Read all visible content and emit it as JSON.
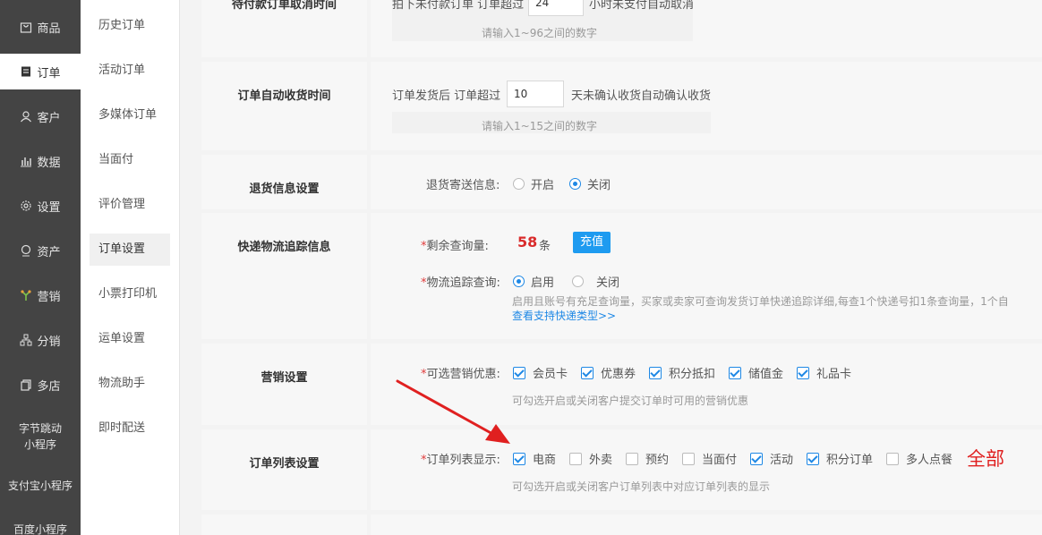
{
  "nav": {
    "items": [
      {
        "label": "商品",
        "icon": "bag-icon"
      },
      {
        "label": "订单",
        "icon": "order-icon"
      },
      {
        "label": "客户",
        "icon": "user-icon"
      },
      {
        "label": "数据",
        "icon": "chart-icon"
      },
      {
        "label": "设置",
        "icon": "gear-icon"
      },
      {
        "label": "资产",
        "icon": "coin-icon"
      },
      {
        "label": "营销",
        "icon": "branch-icon"
      },
      {
        "label": "分销",
        "icon": "share-icon"
      },
      {
        "label": "多店",
        "icon": "store-icon"
      },
      {
        "label": "字节跳动\n小程序"
      },
      {
        "label": "支付宝小程序"
      },
      {
        "label": "百度小程序"
      }
    ]
  },
  "subnav": {
    "items": [
      "历史订单",
      "活动订单",
      "多媒体订单",
      "当面付",
      "评价管理",
      "订单设置",
      "小票打印机",
      "运单设置",
      "物流助手",
      "即时配送"
    ]
  },
  "rows": {
    "cancel": {
      "label": "待付款订单取消时间",
      "prefix": "拍下未付款订单 订单超过",
      "value": "24",
      "suffix": "小时未支付自动取消",
      "hint": "请输入1~96之间的数字"
    },
    "receive": {
      "label": "订单自动收货时间",
      "prefix": "订单发货后 订单超过",
      "value": "10",
      "suffix": "天未确认收货自动确认收货",
      "hint": "请输入1~15之间的数字"
    },
    "returns": {
      "label": "退货信息设置",
      "field": "退货寄送信息:",
      "opt_on": "开启",
      "opt_off": "关闭"
    },
    "express": {
      "label": "快递物流追踪信息",
      "remain_label": "剩余查询量:",
      "remain_value": "58",
      "remain_unit": "条",
      "recharge": "充值",
      "track_label": "物流追踪查询:",
      "opt_on": "启用",
      "opt_off": "关闭",
      "note": "启用且账号有充足查询量，买家或卖家可查询发货订单快递追踪详细,每查1个快递号扣1条查询量，1个自",
      "link": "查看支持快递类型>>"
    },
    "marketing": {
      "label": "营销设置",
      "field": "可选营销优惠:",
      "options": [
        "会员卡",
        "优惠券",
        "积分抵扣",
        "储值金",
        "礼品卡"
      ],
      "hint": "可勾选开启或关闭客户提交订单时可用的营销优惠"
    },
    "orderlist": {
      "label": "订单列表设置",
      "field": "订单列表显示:",
      "options": [
        "电商",
        "外卖",
        "预约",
        "当面付",
        "活动",
        "积分订单",
        "多人点餐"
      ],
      "checked": [
        true,
        false,
        false,
        false,
        true,
        true,
        false
      ],
      "hint": "可勾选开启或关闭客户订单列表中对应订单列表的显示",
      "annotation": "全部"
    }
  },
  "colors": {
    "accent": "#1e88e5",
    "annotation": "#e02020",
    "nav_bg": "#444444"
  }
}
